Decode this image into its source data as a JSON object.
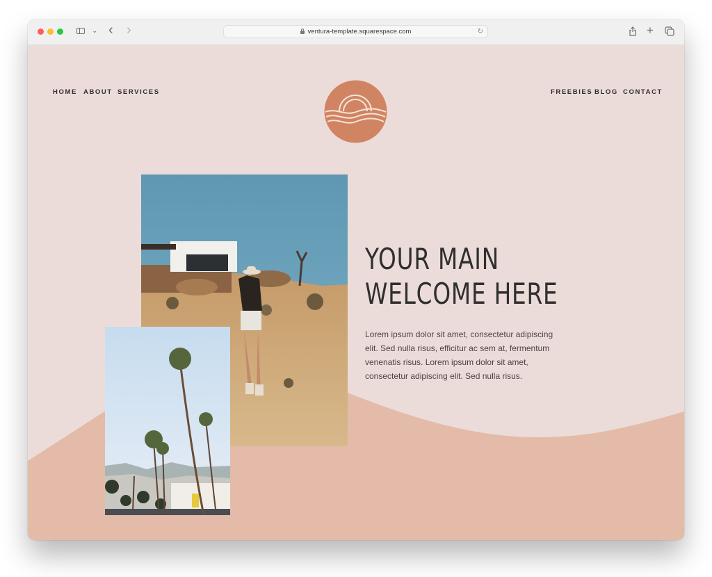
{
  "browser": {
    "url": "ventura-template.squarespace.com",
    "icons": {
      "sidebar": "sidebar-icon",
      "chevron": "chevron-down-icon",
      "back": "back-icon",
      "forward": "forward-icon",
      "lock": "lock-icon",
      "reload": "reload-icon",
      "share": "share-icon",
      "new_tab": "plus-icon",
      "tabs": "tabs-overview-icon"
    },
    "glyphs": {
      "chevron": "⌄",
      "back": "‹",
      "forward": "›",
      "reload": "↻",
      "plus": "+"
    }
  },
  "nav": {
    "left": [
      {
        "label": "HOME"
      },
      {
        "label": "ABOUT"
      },
      {
        "label": "SERVICES"
      }
    ],
    "right": [
      {
        "label": "FREEBIES"
      },
      {
        "label": "BLOG"
      },
      {
        "label": "CONTACT"
      }
    ],
    "logo": "sun-over-waves-logo"
  },
  "hero": {
    "headline_line1": "YOUR MAIN",
    "headline_line2": "WELCOME HERE",
    "body": "Lorem ipsum dolor sit amet, consectetur adipiscing elit. Sed nulla risus, efficitur ac sem at, fermentum venenatis risus. Lorem ipsum dolor sit amet, consectetur adipiscing elit. Sed nulla risus.",
    "images": [
      {
        "name": "desert-woman-photo",
        "description": "Woman in cowboy hat standing in desert near modern white house"
      },
      {
        "name": "palm-trees-photo",
        "description": "Tall palm trees against blue sky with mountains"
      }
    ]
  },
  "colors": {
    "page_bg": "#ecdcd9",
    "wave": "#e3bba8",
    "logo": "#d08462",
    "text": "#2f2f2f"
  }
}
